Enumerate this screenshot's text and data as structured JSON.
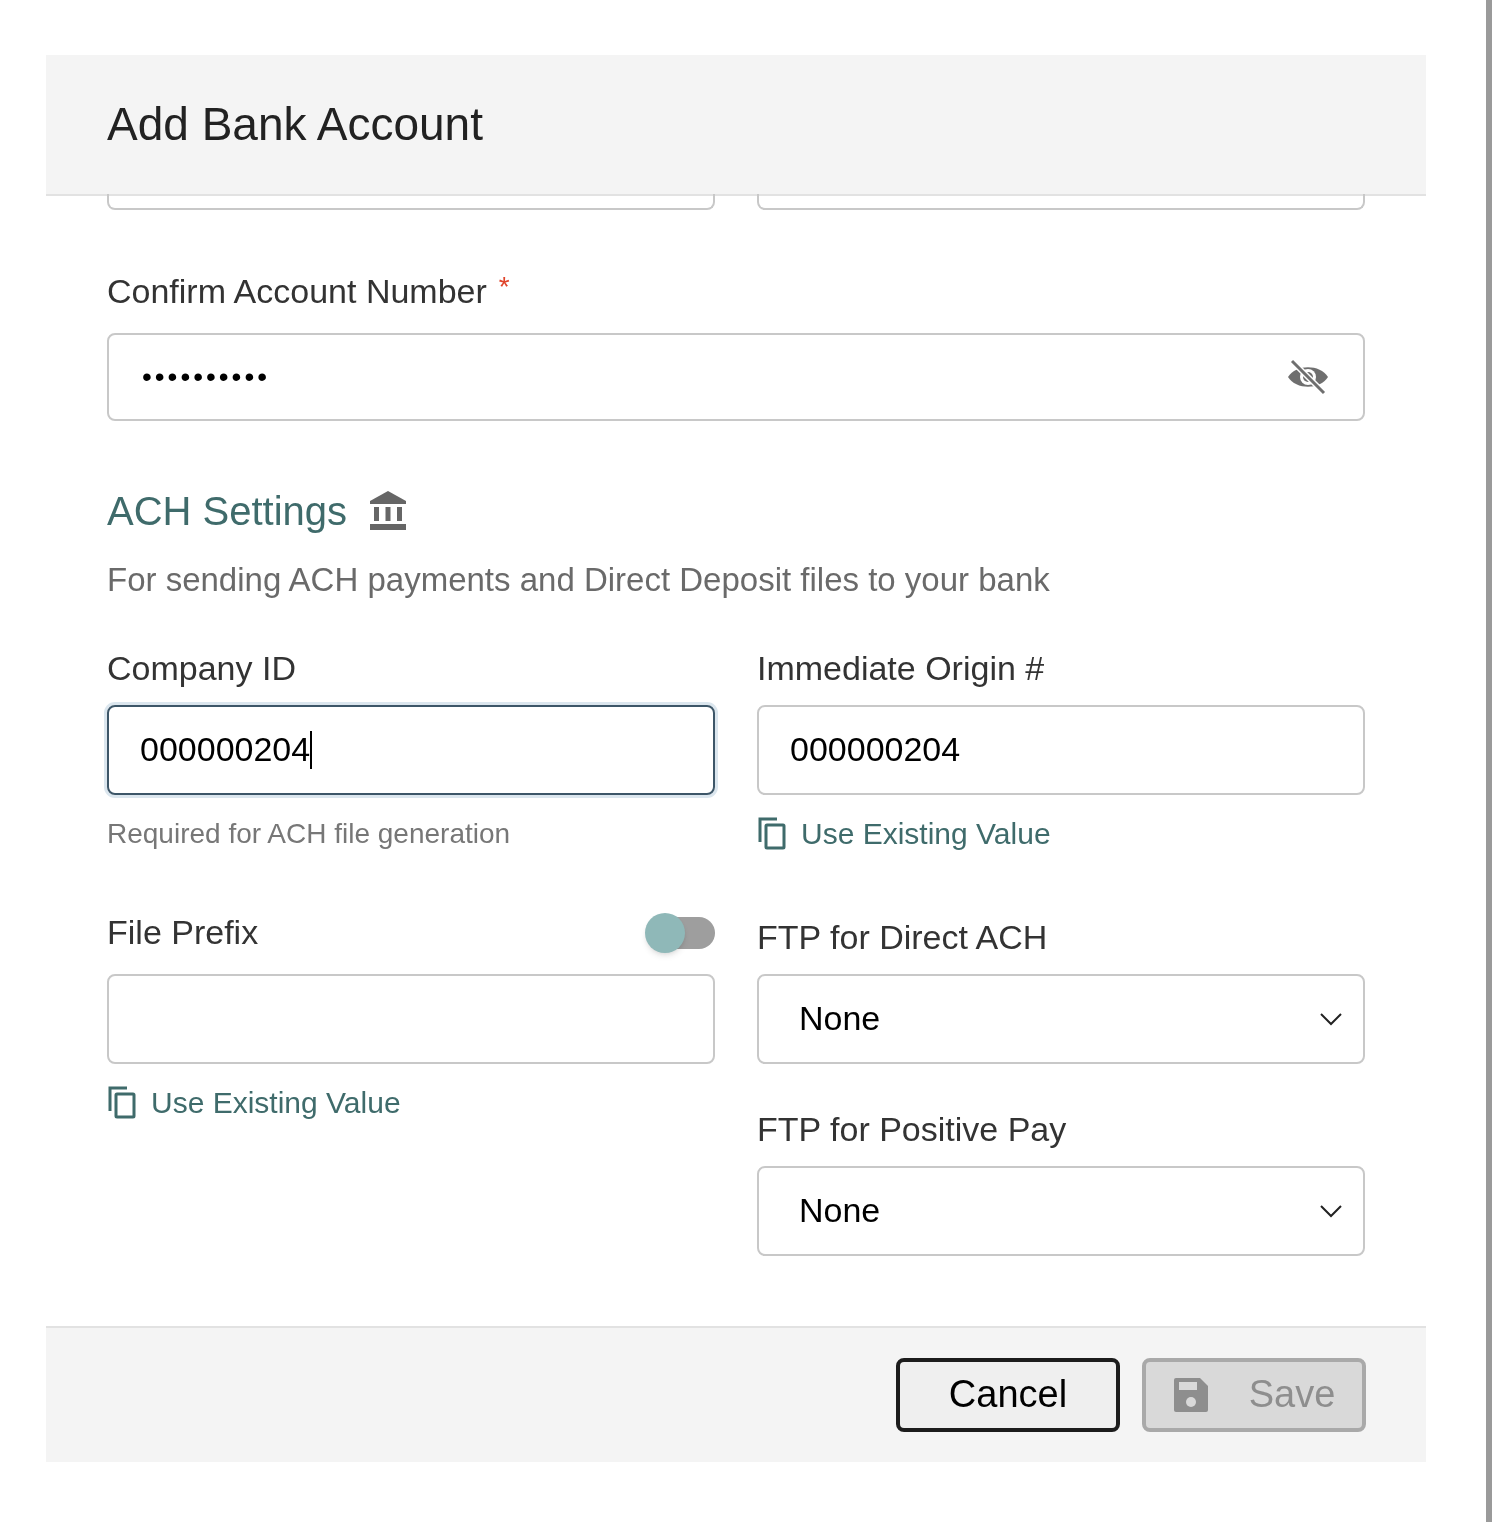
{
  "dialog": {
    "title": "Add Bank Account"
  },
  "confirm_account_number": {
    "label": "Confirm Account Number",
    "required": true,
    "required_mark": "*",
    "value": "••••••••••",
    "masked": true
  },
  "ach_settings": {
    "heading": "ACH Settings",
    "description": "For sending ACH payments and Direct Deposit files to your bank"
  },
  "company_id": {
    "label": "Company ID",
    "value": "000000204",
    "focused": true,
    "hint": "Required for ACH file generation"
  },
  "immediate_origin": {
    "label": "Immediate Origin #",
    "value": "000000204",
    "focused": false,
    "link": "Use Existing Value"
  },
  "file_prefix": {
    "label": "File Prefix",
    "toggle_on": false,
    "link": "Use Existing Value"
  },
  "ftp_direct_ach": {
    "label": "FTP for Direct ACH",
    "value": "None"
  },
  "ftp_positive_pay": {
    "label": "FTP for Positive Pay",
    "value": "None"
  },
  "buttons": [
    {
      "label": "Cancel",
      "kind": "cancel",
      "disabled": false
    },
    {
      "label": "Save",
      "kind": "save",
      "disabled": true
    }
  ]
}
